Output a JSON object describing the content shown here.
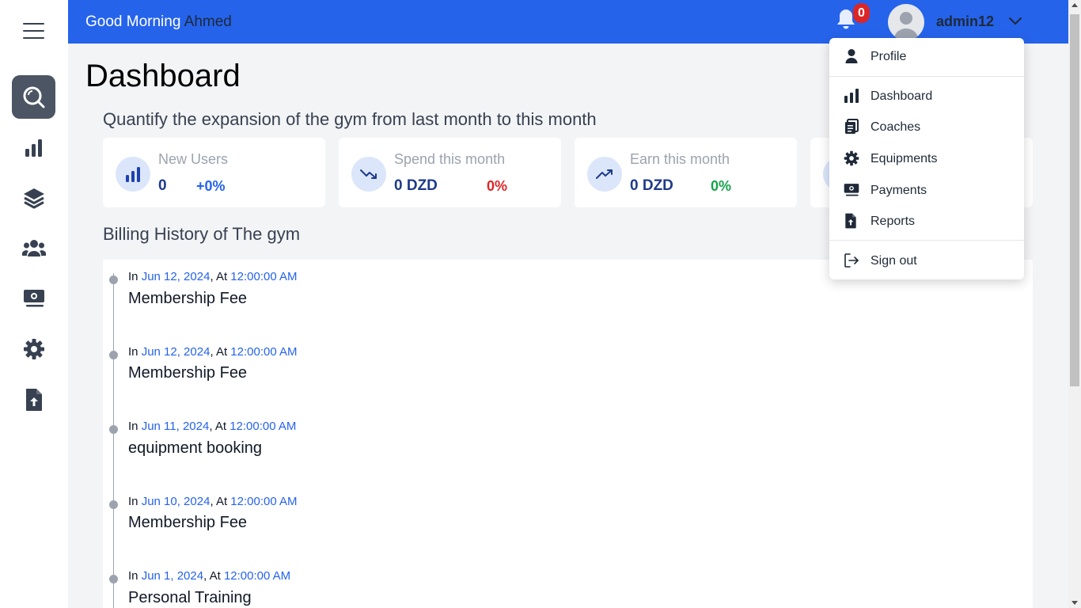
{
  "header": {
    "greeting": "Good Morning",
    "user_first_name": "Ahmed",
    "notification_count": "0",
    "username": "admin12"
  },
  "main": {
    "title": "Dashboard",
    "stats_heading": "Quantify the expansion of the gym from last month to this month",
    "stats": [
      {
        "label": "New Users",
        "value": "0",
        "change": "+0%",
        "change_color": "#2563eb",
        "icon": "bar-chart-icon"
      },
      {
        "label": "Spend this month",
        "value": "0 DZD",
        "change": "0%",
        "change_color": "#dc2626",
        "icon": "trend-down-icon"
      },
      {
        "label": "Earn this month",
        "value": "0 DZD",
        "change": "0%",
        "change_color": "#16a34a",
        "icon": "trend-up-icon"
      }
    ],
    "billing_heading": "Billing History of The gym",
    "billing": [
      {
        "prefix": "In",
        "date": "Jun 12, 2024",
        "at": ", At",
        "time": "12:00:00 AM",
        "title": "Membership Fee"
      },
      {
        "prefix": "In",
        "date": "Jun 12, 2024",
        "at": ", At",
        "time": "12:00:00 AM",
        "title": "Membership Fee"
      },
      {
        "prefix": "In",
        "date": "Jun 11, 2024",
        "at": ", At",
        "time": "12:00:00 AM",
        "title": "equipment booking"
      },
      {
        "prefix": "In",
        "date": "Jun 10, 2024",
        "at": ", At",
        "time": "12:00:00 AM",
        "title": "Membership Fee"
      },
      {
        "prefix": "In",
        "date": "Jun 1, 2024",
        "at": ", At",
        "time": "12:00:00 AM",
        "title": "Personal Training"
      }
    ]
  },
  "dropdown": {
    "items": [
      {
        "label": "Profile",
        "icon": "user-icon"
      },
      {
        "label": "Dashboard",
        "icon": "bar-chart-icon"
      },
      {
        "label": "Coaches",
        "icon": "clipboard-icon"
      },
      {
        "label": "Equipments",
        "icon": "gear-icon"
      },
      {
        "label": "Payments",
        "icon": "money-icon"
      },
      {
        "label": "Reports",
        "icon": "file-upload-icon"
      },
      {
        "label": "Sign out",
        "icon": "sign-out-icon"
      }
    ]
  },
  "colors": {
    "accent": "#2563eb",
    "sidebar_active": "#4b5563",
    "negative": "#dc2626",
    "positive": "#16a34a"
  }
}
